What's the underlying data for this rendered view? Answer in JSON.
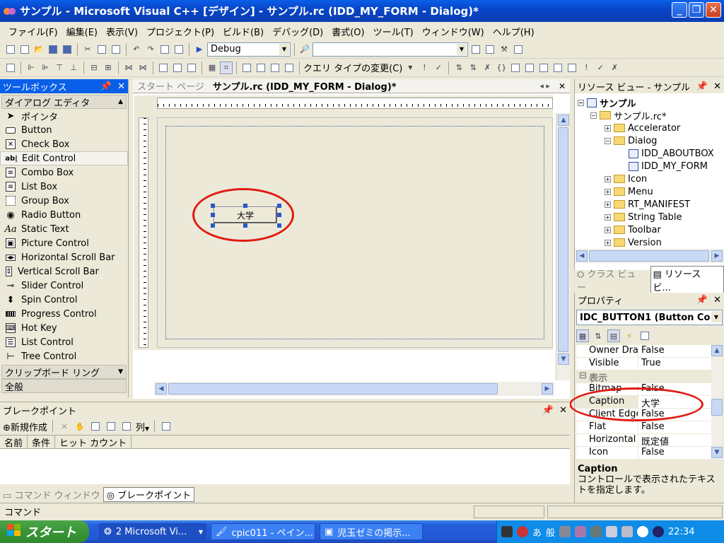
{
  "window": {
    "title": "サンプル - Microsoft Visual C++ [デザイン] - サンプル.rc (IDD_MY_FORM - Dialog)*"
  },
  "menu": [
    "ファイル(F)",
    "編集(E)",
    "表示(V)",
    "プロジェクト(P)",
    "ビルド(B)",
    "デバッグ(D)",
    "書式(O)",
    "ツール(T)",
    "ウィンドウ(W)",
    "ヘルプ(H)"
  ],
  "toolbar1": {
    "config": "Debug",
    "find_value": ""
  },
  "toolbar2": {
    "query_type": "クエリ タイプの変更(C)"
  },
  "toolbox": {
    "title": "ツールボックス",
    "category": "ダイアログ エディタ",
    "items": [
      "ポインタ",
      "Button",
      "Check Box",
      "Edit Control",
      "Combo Box",
      "List Box",
      "Group Box",
      "Radio Button",
      "Static Text",
      "Picture Control",
      "Horizontal Scroll Bar",
      "Vertical Scroll Bar",
      "Slider Control",
      "Spin Control",
      "Progress Control",
      "Hot Key",
      "List Control",
      "Tree Control"
    ],
    "bottom_cat1": "クリップボード リング",
    "bottom_cat2": "全般"
  },
  "doc": {
    "tab_start": "スタート ページ",
    "tab_active": "サンプル.rc (IDD_MY_FORM - Dialog)*"
  },
  "dialog": {
    "button_caption": "大学"
  },
  "resview": {
    "title": "リソース ビュー - サンプル",
    "root": "サンプル",
    "rc": "サンプル.rc*",
    "nodes": [
      "Accelerator",
      "Dialog",
      "IDD_ABOUTBOX",
      "IDD_MY_FORM",
      "Icon",
      "Menu",
      "RT_MANIFEST",
      "String Table",
      "Toolbar",
      "Version"
    ],
    "tab_class": "クラス ビュー",
    "tab_res": "リソース ビ..."
  },
  "props": {
    "title": "プロパティ",
    "object": "IDC_BUTTON1 (Button Co",
    "rows": [
      {
        "n": "Owner Draw",
        "v": "False"
      },
      {
        "n": "Visible",
        "v": "True"
      },
      {
        "n": "表示",
        "v": ""
      },
      {
        "n": "Bitmap",
        "v": "False"
      },
      {
        "n": "Caption",
        "v": "大学"
      },
      {
        "n": "Client Edge",
        "v": "False"
      },
      {
        "n": "Flat",
        "v": "False"
      },
      {
        "n": "Horizontal Al",
        "v": "既定値"
      },
      {
        "n": "Icon",
        "v": "False"
      }
    ],
    "desc_title": "Caption",
    "desc_text": "コントロールで表示されたテキストを指定します。"
  },
  "breakpoints": {
    "title": "ブレークポイント",
    "new": "新規作成",
    "columns_btn": "列",
    "cols": [
      "名前",
      "条件",
      "ヒット カウント"
    ],
    "tab_cmd": "コマンド ウィンドウ",
    "tab_bp": "ブレークポイント"
  },
  "status": {
    "text": "コマンド"
  },
  "taskbar": {
    "start": "スタート",
    "tasks": [
      "2 Microsoft Vi...",
      "cpic011 - ペイン...",
      "児玉ゼミの掲示..."
    ],
    "tray_a": "あ",
    "tray_b": "般",
    "clock": "22:34"
  }
}
